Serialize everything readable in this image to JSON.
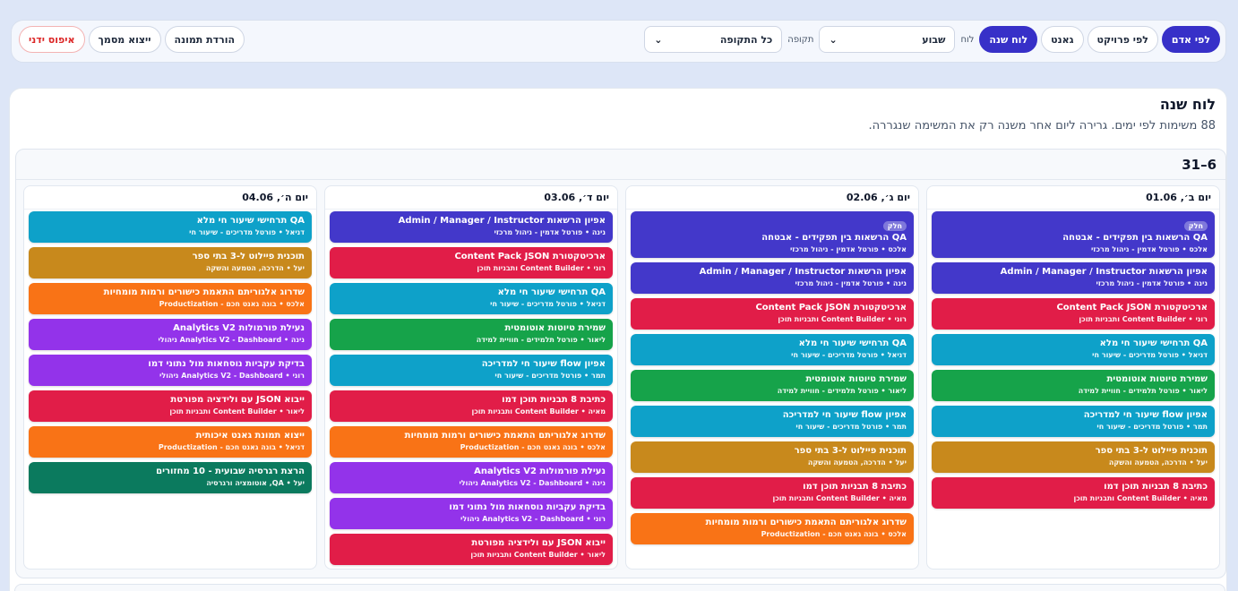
{
  "toolbar": {
    "view_tabs": [
      {
        "label": "לפי אדם",
        "active": true
      },
      {
        "label": "לפי פרויקט",
        "active": false
      },
      {
        "label": "גאנט",
        "active": false
      },
      {
        "label": "לוח שנה",
        "active": true
      }
    ],
    "board_label": "לוח",
    "board_select": "שבוע",
    "period_label": "תקופה",
    "period_select": "כל התקופה",
    "download_image": "הורדת תמונה",
    "export_doc": "ייצוא מסמך",
    "manual_reset": "איפוס ידני"
  },
  "panel": {
    "title": "לוח שנה",
    "subtitle": "88 משימות לפי ימים. גרירה ליום אחר משנה רק את המשימה שנגררה.",
    "week_range": "6–31"
  },
  "colors": {
    "cyan": "#0ea1c9",
    "indigo": "#4338ca",
    "red": "#e11d48",
    "green": "#16a34a",
    "amber": "#c8891c",
    "orange": "#f97316",
    "purple": "#9333ea",
    "teal": "#0b7a5e"
  },
  "days": [
    {
      "label": "יום ב׳, 01.06",
      "tasks": [
        {
          "badge": "חלק",
          "title": "QA הרשאות בין תפקידים - אבטחה",
          "meta": "אלכס • פורטל אדמין - ניהול מרכזי",
          "color": "indigo"
        },
        {
          "title": "אפיון הרשאות Admin / Manager / Instructor",
          "meta": "נינה • פורטל אדמין - ניהול מרכזי",
          "color": "indigo"
        },
        {
          "title": "ארכיטקטורת Content Pack JSON",
          "meta": "רוני • Content Builder ותבניות תוכן",
          "color": "red"
        },
        {
          "title": "QA תרחישי שיעור חי מלא",
          "meta": "דניאל • פורטל מדריכים - שיעור חי",
          "color": "cyan"
        },
        {
          "title": "שמירת טיוטות אוטומטית",
          "meta": "ליאור • פורטל תלמידים - חוויית למידה",
          "color": "green"
        },
        {
          "title": "אפיון flow שיעור חי למדריכה",
          "meta": "תמר • פורטל מדריכים - שיעור חי",
          "color": "cyan"
        },
        {
          "title": "תוכנית פיילוט ל-3 בתי ספר",
          "meta": "יעל • הדרכה, הטמעה והשקה",
          "color": "amber"
        },
        {
          "title": "כתיבת 8 תבניות תוכן דמו",
          "meta": "מאיה • Content Builder ותבניות תוכן",
          "color": "red"
        }
      ]
    },
    {
      "label": "יום ג׳, 02.06",
      "tasks": [
        {
          "badge": "חלק",
          "title": "QA הרשאות בין תפקידים - אבטחה",
          "meta": "אלכס • פורטל אדמין - ניהול מרכזי",
          "color": "indigo"
        },
        {
          "title": "אפיון הרשאות Admin / Manager / Instructor",
          "meta": "נינה • פורטל אדמין - ניהול מרכזי",
          "color": "indigo"
        },
        {
          "title": "ארכיטקטורת Content Pack JSON",
          "meta": "רוני • Content Builder ותבניות תוכן",
          "color": "red"
        },
        {
          "title": "QA תרחישי שיעור חי מלא",
          "meta": "דניאל • פורטל מדריכים - שיעור חי",
          "color": "cyan"
        },
        {
          "title": "שמירת טיוטות אוטומטית",
          "meta": "ליאור • פורטל תלמידים - חוויית למידה",
          "color": "green"
        },
        {
          "title": "אפיון flow שיעור חי למדריכה",
          "meta": "תמר • פורטל מדריכים - שיעור חי",
          "color": "cyan"
        },
        {
          "title": "תוכנית פיילוט ל-3 בתי ספר",
          "meta": "יעל • הדרכה, הטמעה והשקה",
          "color": "amber"
        },
        {
          "title": "כתיבת 8 תבניות תוכן דמו",
          "meta": "מאיה • Content Builder ותבניות תוכן",
          "color": "red"
        },
        {
          "title": "שדרוג אלגוריתם התאמת כישורים ורמות מומחיות",
          "meta": "אלכס • בונה גאנט חכם - Productization",
          "color": "orange"
        }
      ]
    },
    {
      "label": "יום ד׳, 03.06",
      "tasks": [
        {
          "title": "אפיון הרשאות Admin / Manager / Instructor",
          "meta": "נינה • פורטל אדמין - ניהול מרכזי",
          "color": "indigo"
        },
        {
          "title": "ארכיטקטורת Content Pack JSON",
          "meta": "רוני • Content Builder ותבניות תוכן",
          "color": "red"
        },
        {
          "title": "QA תרחישי שיעור חי מלא",
          "meta": "דניאל • פורטל מדריכים - שיעור חי",
          "color": "cyan"
        },
        {
          "title": "שמירת טיוטות אוטומטית",
          "meta": "ליאור • פורטל תלמידים - חוויית למידה",
          "color": "green"
        },
        {
          "title": "אפיון flow שיעור חי למדריכה",
          "meta": "תמר • פורטל מדריכים - שיעור חי",
          "color": "cyan"
        },
        {
          "title": "כתיבת 8 תבניות תוכן דמו",
          "meta": "מאיה • Content Builder ותבניות תוכן",
          "color": "red"
        },
        {
          "title": "שדרוג אלגוריתם התאמת כישורים ורמות מומחיות",
          "meta": "אלכס • בונה גאנט חכם - Productization",
          "color": "orange"
        },
        {
          "title": "נעילת פורמולות Analytics V2",
          "meta": "נינה • Analytics V2 - Dashboard ניהולי",
          "color": "purple"
        },
        {
          "title": "בדיקת עקביות נוסחאות מול נתוני דמו",
          "meta": "רוני • Analytics V2 - Dashboard ניהולי",
          "color": "purple"
        },
        {
          "title": "ייבוא JSON עם ולידציה מפורטת",
          "meta": "ליאור • Content Builder ותבניות תוכן",
          "color": "red"
        }
      ]
    },
    {
      "label": "יום ה׳, 04.06",
      "tasks": [
        {
          "title": "QA תרחישי שיעור חי מלא",
          "meta": "דניאל • פורטל מדריכים - שיעור חי",
          "color": "cyan"
        },
        {
          "title": "תוכנית פיילוט ל-3 בתי ספר",
          "meta": "יעל • הדרכה, הטמעה והשקה",
          "color": "amber"
        },
        {
          "title": "שדרוג אלגוריתם התאמת כישורים ורמות מומחיות",
          "meta": "אלכס • בונה גאנט חכם - Productization",
          "color": "orange"
        },
        {
          "title": "נעילת פורמולות Analytics V2",
          "meta": "נינה • Analytics V2 - Dashboard ניהולי",
          "color": "purple"
        },
        {
          "title": "בדיקת עקביות נוסחאות מול נתוני דמו",
          "meta": "רוני • Analytics V2 - Dashboard ניהולי",
          "color": "purple"
        },
        {
          "title": "ייבוא JSON עם ולידציה מפורטת",
          "meta": "ליאור • Content Builder ותבניות תוכן",
          "color": "red"
        },
        {
          "title": "ייצוא תמונת גאנט איכותית",
          "meta": "דניאל • בונה גאנט חכם - Productization",
          "color": "orange"
        },
        {
          "title": "הרצת רגרסיה שבועית - 10 מחזורים",
          "meta": "יעל • QA, אוטומציה ורגרסיה",
          "color": "teal"
        }
      ]
    }
  ]
}
